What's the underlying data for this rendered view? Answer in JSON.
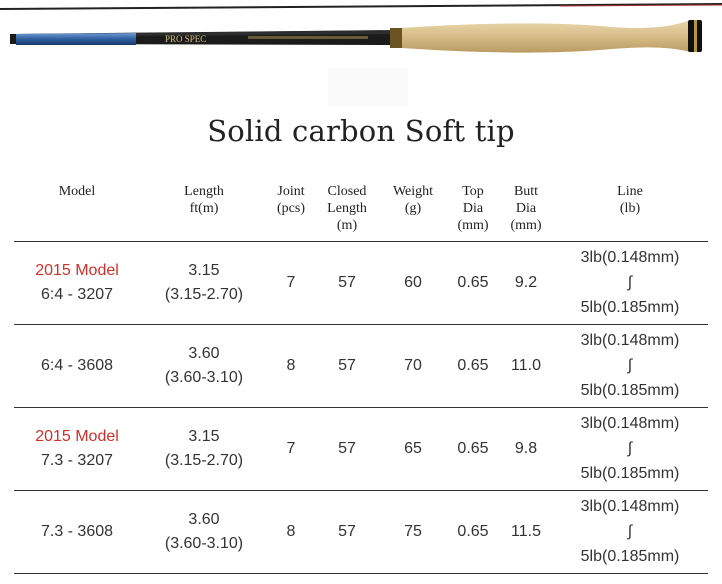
{
  "product_image": {
    "rod_print_text": "PRO SPEC"
  },
  "title": "Solid carbon Soft tip",
  "table": {
    "headers": [
      {
        "lines": [
          "Model"
        ]
      },
      {
        "lines": [
          "Length",
          "ft(m)"
        ]
      },
      {
        "lines": [
          "Joint",
          "(pcs)"
        ]
      },
      {
        "lines": [
          "Closed",
          "Length",
          "(m)"
        ]
      },
      {
        "lines": [
          "Weight",
          "(g)"
        ]
      },
      {
        "lines": [
          "Top",
          "Dia",
          "(mm)"
        ]
      },
      {
        "lines": [
          "Butt",
          "Dia",
          "(mm)"
        ]
      },
      {
        "lines": [
          "Line",
          "(lb)"
        ]
      }
    ],
    "rows": [
      {
        "tag": "2015 Model",
        "model": "6:4 - 3207",
        "length": "3.15",
        "length_range": "(3.15-2.70)",
        "joint": "7",
        "closed": "57",
        "weight": "60",
        "top": "0.65",
        "butt": "9.2",
        "line_min": "3lb(0.148mm)",
        "line_sep": "∫",
        "line_max": "5lb(0.185mm)"
      },
      {
        "tag": "",
        "model": "6:4 - 3608",
        "length": "3.60",
        "length_range": "(3.60-3.10)",
        "joint": "8",
        "closed": "57",
        "weight": "70",
        "top": "0.65",
        "butt": "11.0",
        "line_min": "3lb(0.148mm)",
        "line_sep": "∫",
        "line_max": "5lb(0.185mm)"
      },
      {
        "tag": "2015 Model",
        "model": "7.3 - 3207",
        "length": "3.15",
        "length_range": "(3.15-2.70)",
        "joint": "7",
        "closed": "57",
        "weight": "65",
        "top": "0.65",
        "butt": "9.8",
        "line_min": "3lb(0.148mm)",
        "line_sep": "∫",
        "line_max": "5lb(0.185mm)"
      },
      {
        "tag": "",
        "model": "7.3 - 3608",
        "length": "3.60",
        "length_range": "(3.60-3.10)",
        "joint": "8",
        "closed": "57",
        "weight": "75",
        "top": "0.65",
        "butt": "11.5",
        "line_min": "3lb(0.148mm)",
        "line_sep": "∫",
        "line_max": "5lb(0.185mm)"
      }
    ]
  },
  "colors": {
    "accent_red": "#d0302a",
    "rule": "#333333",
    "cork": "#d9c08f",
    "rod_blue": "#2f5f9f"
  }
}
